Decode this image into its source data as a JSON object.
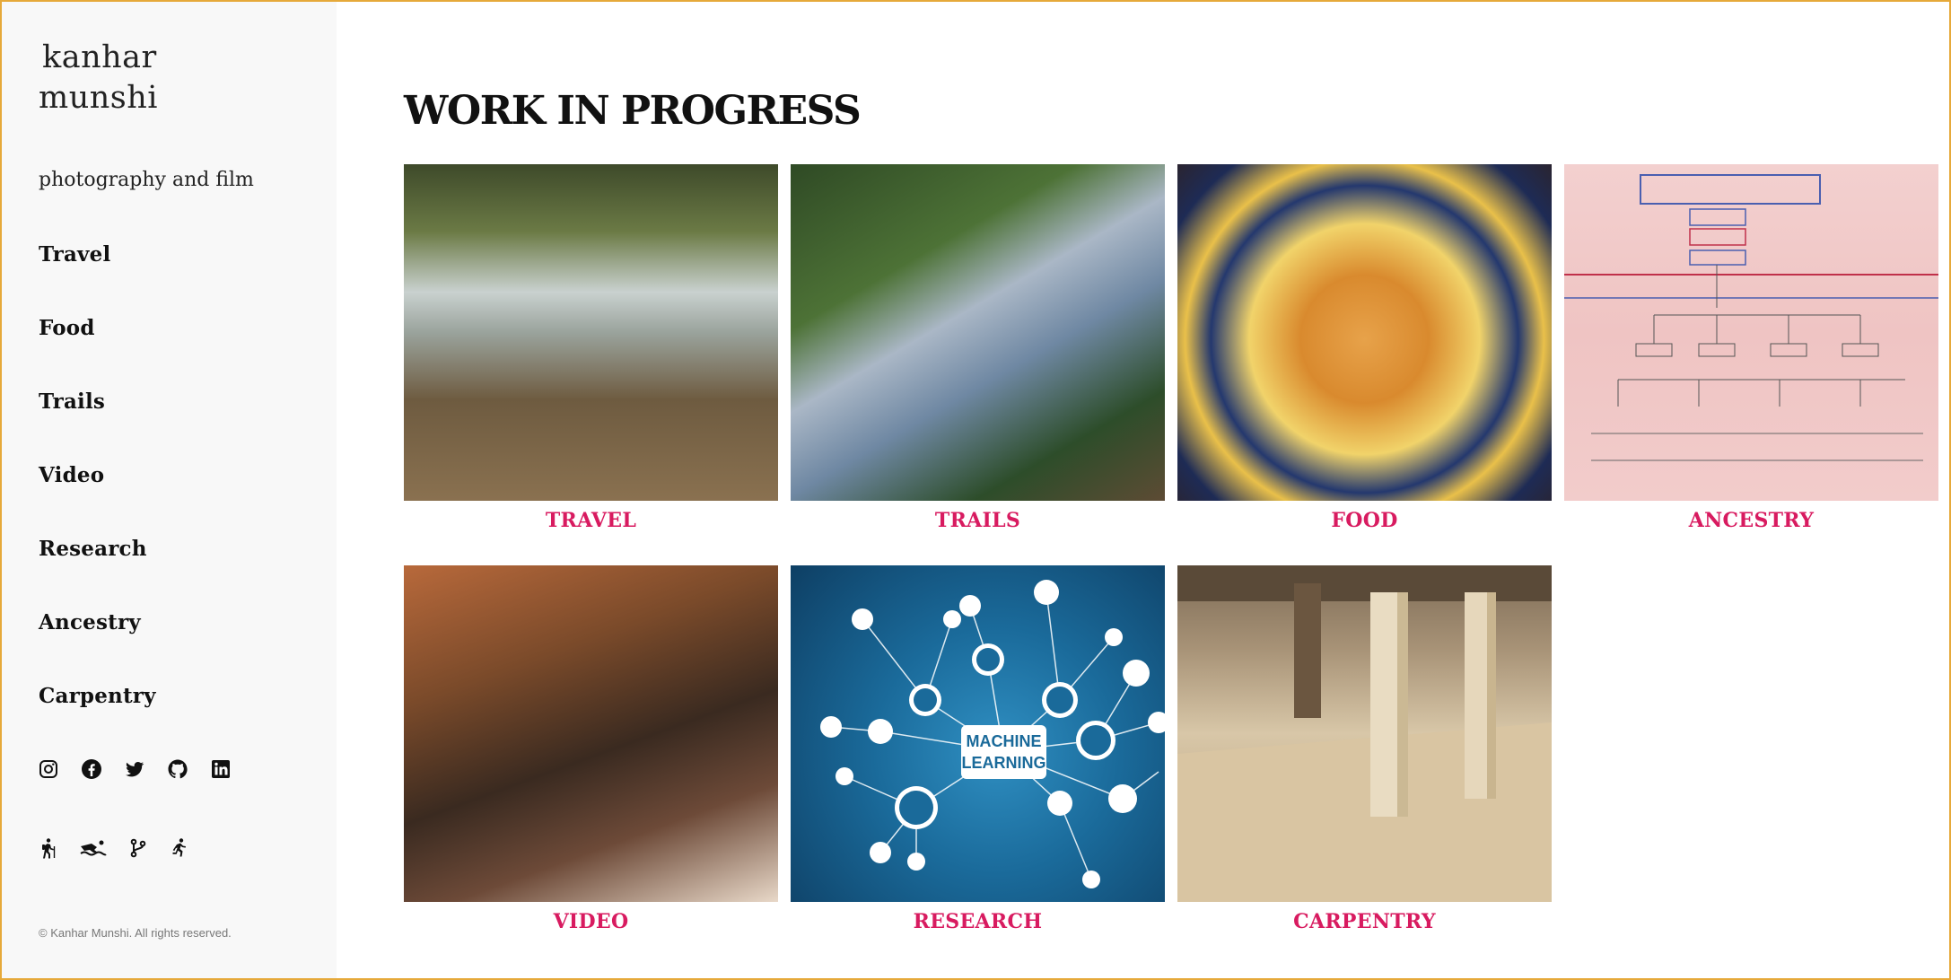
{
  "site": {
    "title_line1": "kanhar",
    "title_line2": "munshi",
    "tagline": "photography and film",
    "copyright": "© Kanhar Munshi. All rights reserved."
  },
  "nav": {
    "items": [
      {
        "label": "Travel"
      },
      {
        "label": "Food"
      },
      {
        "label": "Trails"
      },
      {
        "label": "Video"
      },
      {
        "label": "Research"
      },
      {
        "label": "Ancestry"
      },
      {
        "label": "Carpentry"
      }
    ]
  },
  "social_icons": [
    "instagram-icon",
    "facebook-icon",
    "twitter-icon",
    "github-icon",
    "linkedin-icon"
  ],
  "activity_icons": [
    "hiking-icon",
    "swimming-icon",
    "git-branch-icon",
    "running-icon"
  ],
  "main": {
    "heading": "WORK IN PROGRESS",
    "ml_box_text": "MACHINE LEARNING",
    "tiles": [
      {
        "label": "TRAVEL"
      },
      {
        "label": "TRAILS"
      },
      {
        "label": "FOOD"
      },
      {
        "label": "ANCESTRY"
      },
      {
        "label": "VIDEO"
      },
      {
        "label": "RESEARCH"
      },
      {
        "label": "CARPENTRY"
      }
    ]
  },
  "colors": {
    "accent": "#d81b60",
    "sidebar_bg": "#f8f8f8",
    "frame_border": "#e6a93a"
  }
}
